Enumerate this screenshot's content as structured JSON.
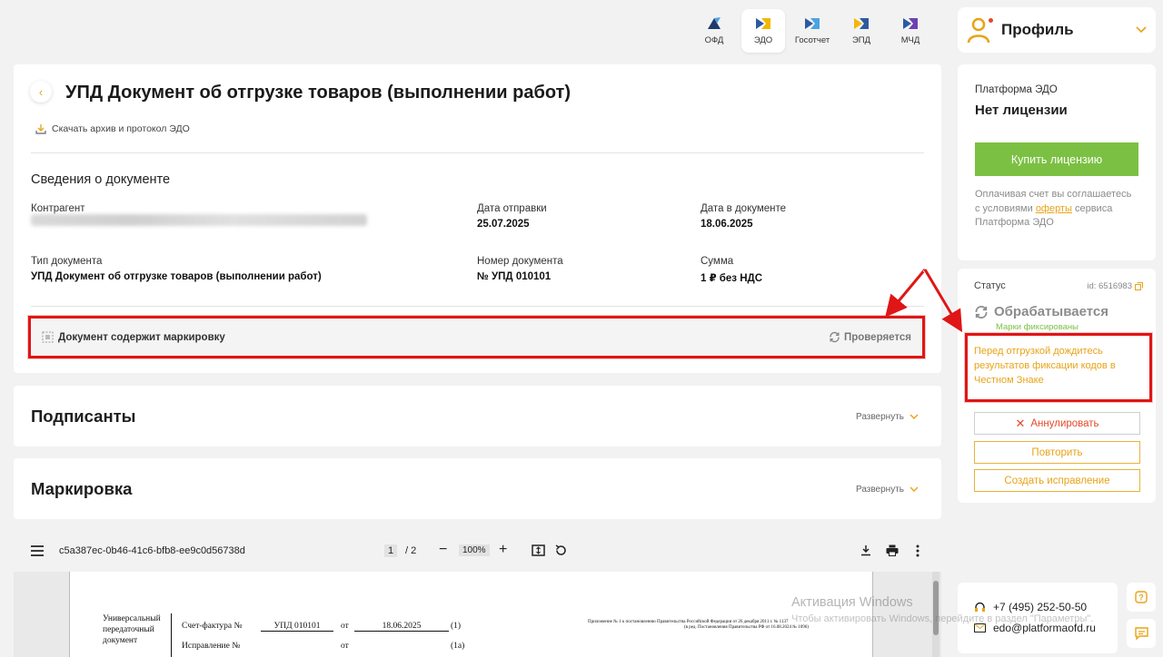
{
  "services": [
    {
      "label": "ОФД",
      "active": false,
      "colors": [
        "#1f3a6b",
        "#4aa3df"
      ]
    },
    {
      "label": "ЭДО",
      "active": true,
      "colors": [
        "#2c5aa0",
        "#f2b705"
      ]
    },
    {
      "label": "Госотчет",
      "active": false,
      "colors": [
        "#2c5aa0",
        "#4aa3df"
      ]
    },
    {
      "label": "ЭПД",
      "active": false,
      "colors": [
        "#f2b705",
        "#2c5aa0"
      ]
    },
    {
      "label": "МЧД",
      "active": false,
      "colors": [
        "#2c5aa0",
        "#6c3fb5"
      ]
    }
  ],
  "profile": {
    "label": "Профиль"
  },
  "document": {
    "title": "УПД Документ об отгрузке товаров (выполнении работ)",
    "download_label": "Скачать архив и протокол ЭДО",
    "section_title": "Сведения о документе",
    "fields": {
      "counterparty_label": "Контрагент",
      "sent_date_label": "Дата отправки",
      "sent_date": "25.07.2025",
      "doc_date_label": "Дата в документе",
      "doc_date": "18.06.2025",
      "doc_type_label": "Тип документа",
      "doc_type": "УПД Документ об отгрузке товаров (выполнении работ)",
      "doc_number_label": "Номер документа",
      "doc_number": "№ УПД 010101",
      "sum_label": "Сумма",
      "sum": "1 ₽ без НДС"
    },
    "marking": {
      "label": "Документ содержит маркировку",
      "status": "Проверяется"
    }
  },
  "sections": [
    {
      "title": "Подписанты",
      "expand_label": "Развернуть"
    },
    {
      "title": "Маркировка",
      "expand_label": "Развернуть"
    }
  ],
  "pdf": {
    "filename": "c5a387ec-0b46-41c6-bfb8-ee9c0d56738d",
    "page_current": "1",
    "page_total": "/ 2",
    "zoom": "100%",
    "minus": "−",
    "plus": "+",
    "content": {
      "upd_title": [
        "Универсальный",
        "передаточный",
        "документ"
      ],
      "invoice_label": "Счет-фактура №",
      "invoice_number": "УПД 010101",
      "from": "от",
      "invoice_date": "18.06.2025",
      "row1": "(1)",
      "correction_label": "Исправление №",
      "from2": "от",
      "row1a": "(1а)",
      "appendix_1": "Приложение № 1 к постановлению Правительства Российской Федерации от 26 декабря 2011 г. № 1137",
      "appendix_2": "(в ред. Постановления Правительства РФ от 16.08.2024 № 1096)"
    }
  },
  "license": {
    "platform_label": "Платформа ЭДО",
    "status": "Нет лицензии",
    "buy_button": "Купить лицензию",
    "note_prefix": "Оплачивая счет вы соглашаетесь с условиями ",
    "note_link": "оферты",
    "note_suffix": " сервиса Платформа ЭДО"
  },
  "status": {
    "label": "Статус",
    "id": "id: 6516983",
    "value": "Обрабатывается",
    "sub": "Марки фиксированы",
    "warning": "Перед отгрузкой дождитесь результатов фиксации кодов в Честном Знаке",
    "buttons": {
      "cancel": "Аннулировать",
      "repeat": "Повторить",
      "create_fix": "Создать исправление"
    }
  },
  "contacts": {
    "phone": "+7 (495) 252-50-50",
    "email": "edo@platformaofd.ru"
  },
  "watermark": {
    "title": "Активация Windows",
    "subtitle": "Чтобы активировать Windows, перейдите в раздел \"Параметры\"."
  },
  "colors": {
    "accent": "#e8a317",
    "green": "#7bc043",
    "annotation_red": "#e01515"
  }
}
